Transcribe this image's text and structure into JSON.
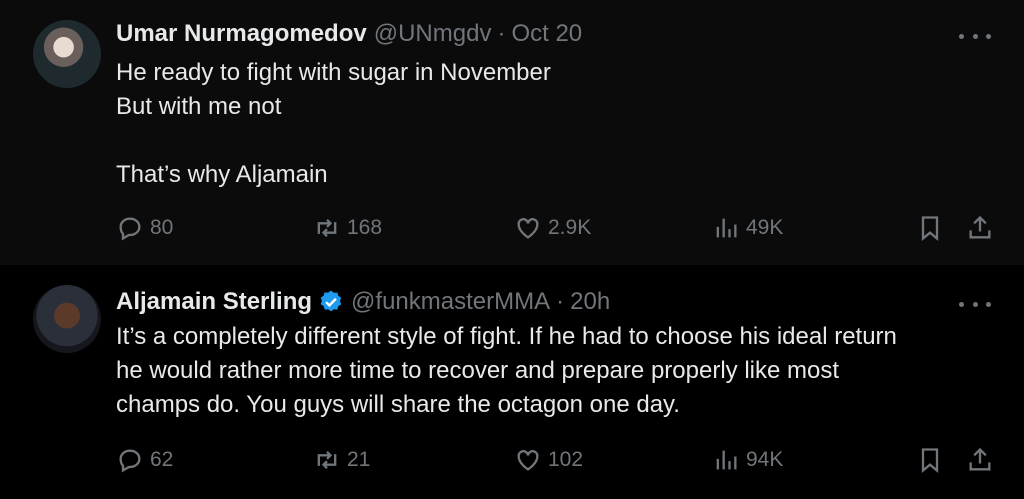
{
  "tweets": [
    {
      "name": "Umar Nurmagomedov",
      "handle": "@UNmgdv",
      "separator": "·",
      "time": "Oct 20",
      "verified": false,
      "lines": [
        "He ready to fight with sugar in November",
        "But with me not",
        "",
        "That’s why Aljamain"
      ],
      "replies": "80",
      "reposts": "168",
      "likes": "2.9K",
      "views": "49K"
    },
    {
      "name": "Aljamain Sterling",
      "handle": "@funkmasterMMA",
      "separator": "·",
      "time": "20h",
      "verified": true,
      "lines": [
        "It’s a completely different style of fight. If he had to choose his ideal return",
        "he would rather more time to recover and prepare properly like most",
        "champs do. You guys will share the octagon one day."
      ],
      "replies": "62",
      "reposts": "21",
      "likes": "102",
      "views": "94K"
    }
  ],
  "colors": {
    "background": "#000000",
    "text": "#e7e9ea",
    "muted": "#71767b",
    "verified": "#1d9bf0"
  },
  "icons": [
    "reply-icon",
    "repost-icon",
    "like-icon",
    "views-icon",
    "bookmark-icon",
    "share-icon",
    "more-icon",
    "verified-badge-icon"
  ]
}
